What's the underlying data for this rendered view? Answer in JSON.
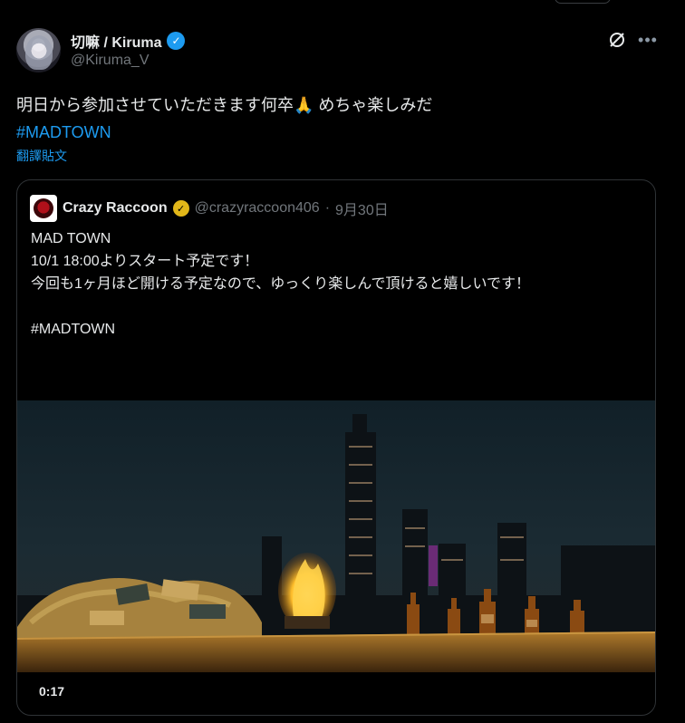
{
  "author": {
    "display_name": "切嘛 / Kiruma",
    "handle": "@Kiruma_V",
    "verified_icon": "verified-badge-icon"
  },
  "tweet": {
    "text": "明日から参加させていただきます何卒🙏 めちゃ楽しみだ",
    "hashtag": "#MADTOWN",
    "translate_label": "翻譯貼文"
  },
  "quote": {
    "name": "Crazy Raccoon",
    "handle": "@crazyraccoon406",
    "separator": "·",
    "date": "9月30日",
    "body": "MAD TOWN\n10/1 18:00よりスタート予定です！\n今回も1ヶ月ほど開ける予定なので、ゆっくり楽しんで頂けると嬉しいです！\n\n#MADTOWN",
    "video_duration": "0:17"
  },
  "colors": {
    "background": "#000000",
    "text": "#e7e9ea",
    "muted": "#71767b",
    "accent": "#1d9bf0",
    "gold_badge": "#e2b719"
  }
}
